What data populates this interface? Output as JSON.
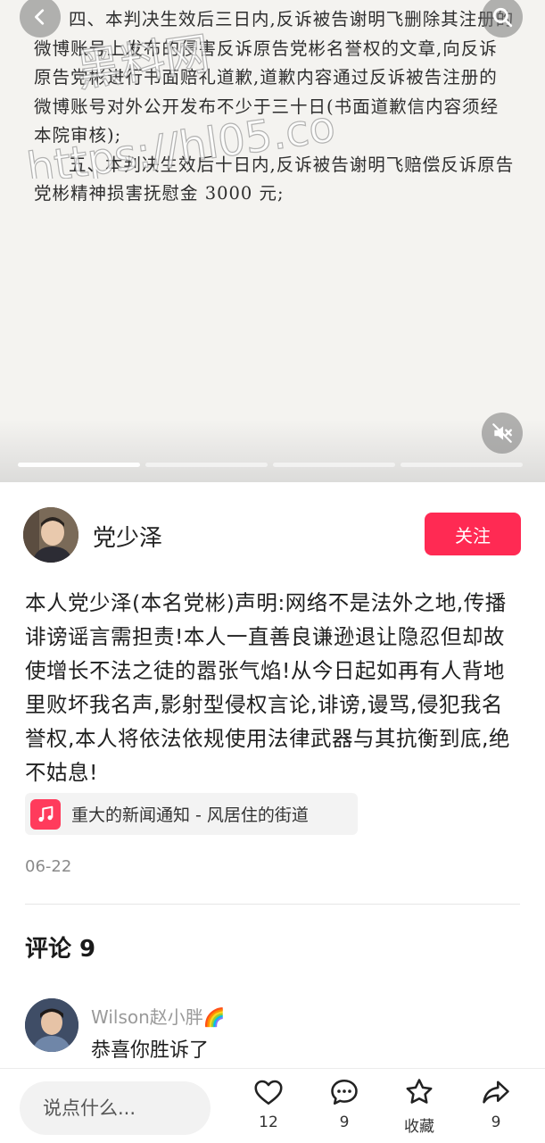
{
  "media": {
    "document_paragraphs": [
      "四、本判决生效后三日内,反诉被告谢明飞删除其注册的微博账号上发布的侵害反诉原告党彬名誉权的文章,向反诉原告党彬进行书面赔礼道歉,道歉内容通过反诉被告注册的微博账号对外公开发布不少于三十日(书面道歉信内容须经本院审核);",
      "五、本判决生效后十日内,反诉被告谢明飞赔偿反诉原告党彬精神损害抚慰金 3000 元;"
    ],
    "watermark_lines": [
      "黑料网",
      "https://hl05.co"
    ],
    "icons": {
      "back": "chevron-left-icon",
      "search": "search-icon",
      "mute": "speaker-muted-icon"
    },
    "progress_segments": 4,
    "progress_active_index": 0
  },
  "author": {
    "name": "党少泽",
    "follow_label": "关注"
  },
  "post": {
    "text": "本人党少泽(本名党彬)声明:网络不是法外之地,传播诽谤谣言需担责!本人一直善良谦逊退让隐忍但却故使增长不法之徒的嚣张气焰!从今日起如再有人背地里败坏我名声,影射型侵权言论,诽谤,谩骂,侵犯我名誉权,本人将依法依规使用法律武器与其抗衡到底,绝不姑息!",
    "music": "重大的新闻通知 - 风居住的街道",
    "date": "06-22"
  },
  "comments": {
    "title": "评论 9",
    "items": [
      {
        "user": "Wilson赵小胖🌈",
        "text": "恭喜你胜诉了"
      }
    ]
  },
  "bottom_bar": {
    "input_placeholder": "说点什么...",
    "like_count": "12",
    "comment_count": "9",
    "favorite_label": "收藏",
    "share_count": "9"
  },
  "colors": {
    "accent": "#ff2a53",
    "music_icon_bg": "#ff3b5c"
  }
}
